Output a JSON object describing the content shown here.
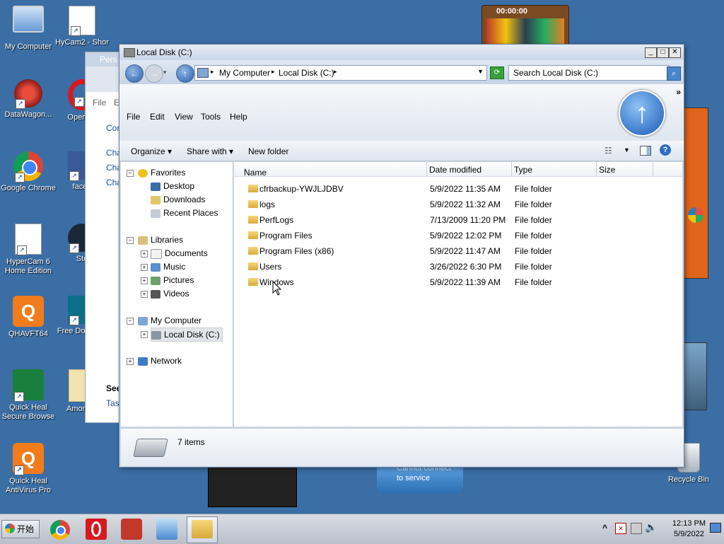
{
  "desktop": {
    "icons": [
      {
        "label": "My Computer"
      },
      {
        "label": "HyCam2 - Shor"
      },
      {
        "label": "DataWagon..."
      },
      {
        "label": "Opera B"
      },
      {
        "label": "Google Chrome"
      },
      {
        "label": "faceb"
      },
      {
        "label": "HyperCam 6 Home Edition"
      },
      {
        "label": "Ste"
      },
      {
        "label": "QHAVFT64"
      },
      {
        "label": "Free Do Mana"
      },
      {
        "label": "Quick Heal Secure Browse"
      },
      {
        "label": "Among..."
      },
      {
        "label": "Quick Heal AntiVirus Pro"
      },
      {
        "label": "Recycle Bin"
      }
    ],
    "timer_gadget": "00:00:00",
    "bg_window": {
      "title": "Pers",
      "menu": [
        "File",
        "E"
      ],
      "items": [
        "Con",
        "Cha",
        "Cha",
        "Cha"
      ],
      "see": "See",
      "task": "Task"
    },
    "weather_gadget": {
      "line1": "Cannot connect",
      "line2": "to service"
    }
  },
  "explorer": {
    "title": "Local Disk (C:)",
    "address": {
      "crumb1": "My Computer",
      "crumb2": "Local Disk (C:)"
    },
    "search_placeholder": "Search Local Disk (C:)",
    "menu": [
      "File",
      "Edit",
      "View",
      "Tools",
      "Help"
    ],
    "toolbar": {
      "organize": "Organize",
      "share_with": "Share with",
      "new_folder": "New folder"
    },
    "nav": {
      "favorites": "Favorites",
      "desktop": "Desktop",
      "downloads": "Downloads",
      "recent": "Recent Places",
      "libraries": "Libraries",
      "documents": "Documents",
      "music": "Music",
      "pictures": "Pictures",
      "videos": "Videos",
      "my_computer": "My Computer",
      "local_disk": "Local Disk (C:)",
      "network": "Network"
    },
    "columns": {
      "name": "Name",
      "date": "Date modified",
      "type": "Type",
      "size": "Size"
    },
    "rows": [
      {
        "name": "cfrbackup-YWJLJDBV",
        "date": "5/9/2022 11:35 AM",
        "type": "File folder"
      },
      {
        "name": "logs",
        "date": "5/9/2022 11:32 AM",
        "type": "File folder"
      },
      {
        "name": "PerfLogs",
        "date": "7/13/2009 11:20 PM",
        "type": "File folder"
      },
      {
        "name": "Program Files",
        "date": "5/9/2022 12:02 PM",
        "type": "File folder"
      },
      {
        "name": "Program Files (x86)",
        "date": "5/9/2022 11:47 AM",
        "type": "File folder"
      },
      {
        "name": "Users",
        "date": "3/26/2022 6:30 PM",
        "type": "File folder"
      },
      {
        "name": "Windows",
        "date": "5/9/2022 11:39 AM",
        "type": "File folder"
      }
    ],
    "status": "7 items"
  },
  "taskbar": {
    "start_label": "开始",
    "time": "12:13 PM",
    "date": "5/9/2022"
  }
}
